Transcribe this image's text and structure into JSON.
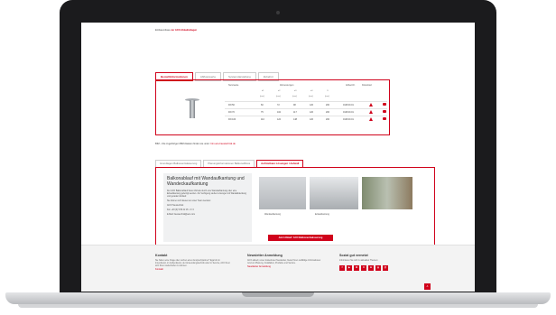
{
  "top_note": {
    "prefix": "Einbauvorlaue",
    "link": "zur ACO Ablaufanlagen"
  },
  "product_tabs": [
    "Bestellinformationen",
    "Abflusswerte",
    "Systemdarstellung",
    "Zubehör"
  ],
  "table": {
    "headers": {
      "nennweite": "Nennweite",
      "abmessungen": "Abmessungen",
      "artikel": "Artikel-Nr.",
      "download": "Download",
      "merken": "Merken"
    },
    "dim_cols": [
      "d1",
      "d2",
      "d3",
      "d4",
      "l1"
    ],
    "unit": "[mm]",
    "rows": [
      {
        "dn": "DN 50",
        "vals": [
          "60",
          "72",
          "98",
          "120",
          "200"
        ],
        "art": "0115.00.01"
      },
      {
        "dn": "DN 70",
        "vals": [
          "75",
          "102",
          "117",
          "120",
          "200"
        ],
        "art": "0115.00.01"
      },
      {
        "dn": "DN 100",
        "vals": [
          "110",
          "122",
          "148",
          "120",
          "200"
        ],
        "art": "0115.00.01"
      }
    ]
  },
  "note2": {
    "prefix": "BIM – Die zugehörigen BIM-Dateien finden sie unter:",
    "link": "bim.aco-haustechnik.de"
  },
  "info_tabs": [
    "Grundlagen Balkonentwässerung",
    "Planungsinformationen Balkonabfluss",
    "Aufrüstbare Lösungen / Aufwall"
  ],
  "info": {
    "title": "Balkonablauf mit Wandaufkantung und Wandeckaufkantung",
    "p1": "Der ACO Balkonablauf bietet Vorteile durch eine Wandaufkantung oder eine Eckaufkantung gefertigt werden. Zur Verfügung stehen Lösungen mit Wandabdeckung und geradem Einlauf.",
    "p2": "Sie können sich diesen an unser Team wenden:",
    "contact1": "ACO Haustechnik",
    "contact2": "Fon +49 (0) 5 89 42 18 - 0 / 0",
    "contact3": "E-Mail: haustechnik@aco.com",
    "caption1": "Wandaufkantung",
    "caption2": "Eckaufkantung",
    "cta": "Jetzt Ablauf: ACO Balkonentwässerung"
  },
  "footer": {
    "kontakt_title": "Kontakt",
    "kontakt_text": "Sie haben eine Frage oder suchen einen Ansprechpartner? Egal ob im Innendienst, im Außendienst, der Anwendungstechnik oder im Service, ACO freut sich Ihnen weiterhelfen zu können.",
    "kontakt_link": "Kontakt",
    "news_title": "Newsletter Anmeldung",
    "news_text": "ACO aktuell, unser kostenloser Newsletter, bietet Ihnen vielfältige Informationen rund um Planung, Installation, Produkte und Service.",
    "news_link": "Newsletter Anmeldung",
    "social_title": "Sozial gut vernetzt",
    "social_text": "Informieren Sie sich zu aktuellen Themen:",
    "social_icons": [
      "f",
      "▶",
      "✉",
      "X",
      "in",
      "◎",
      "@"
    ]
  },
  "colors": {
    "accent": "#d0021b"
  }
}
